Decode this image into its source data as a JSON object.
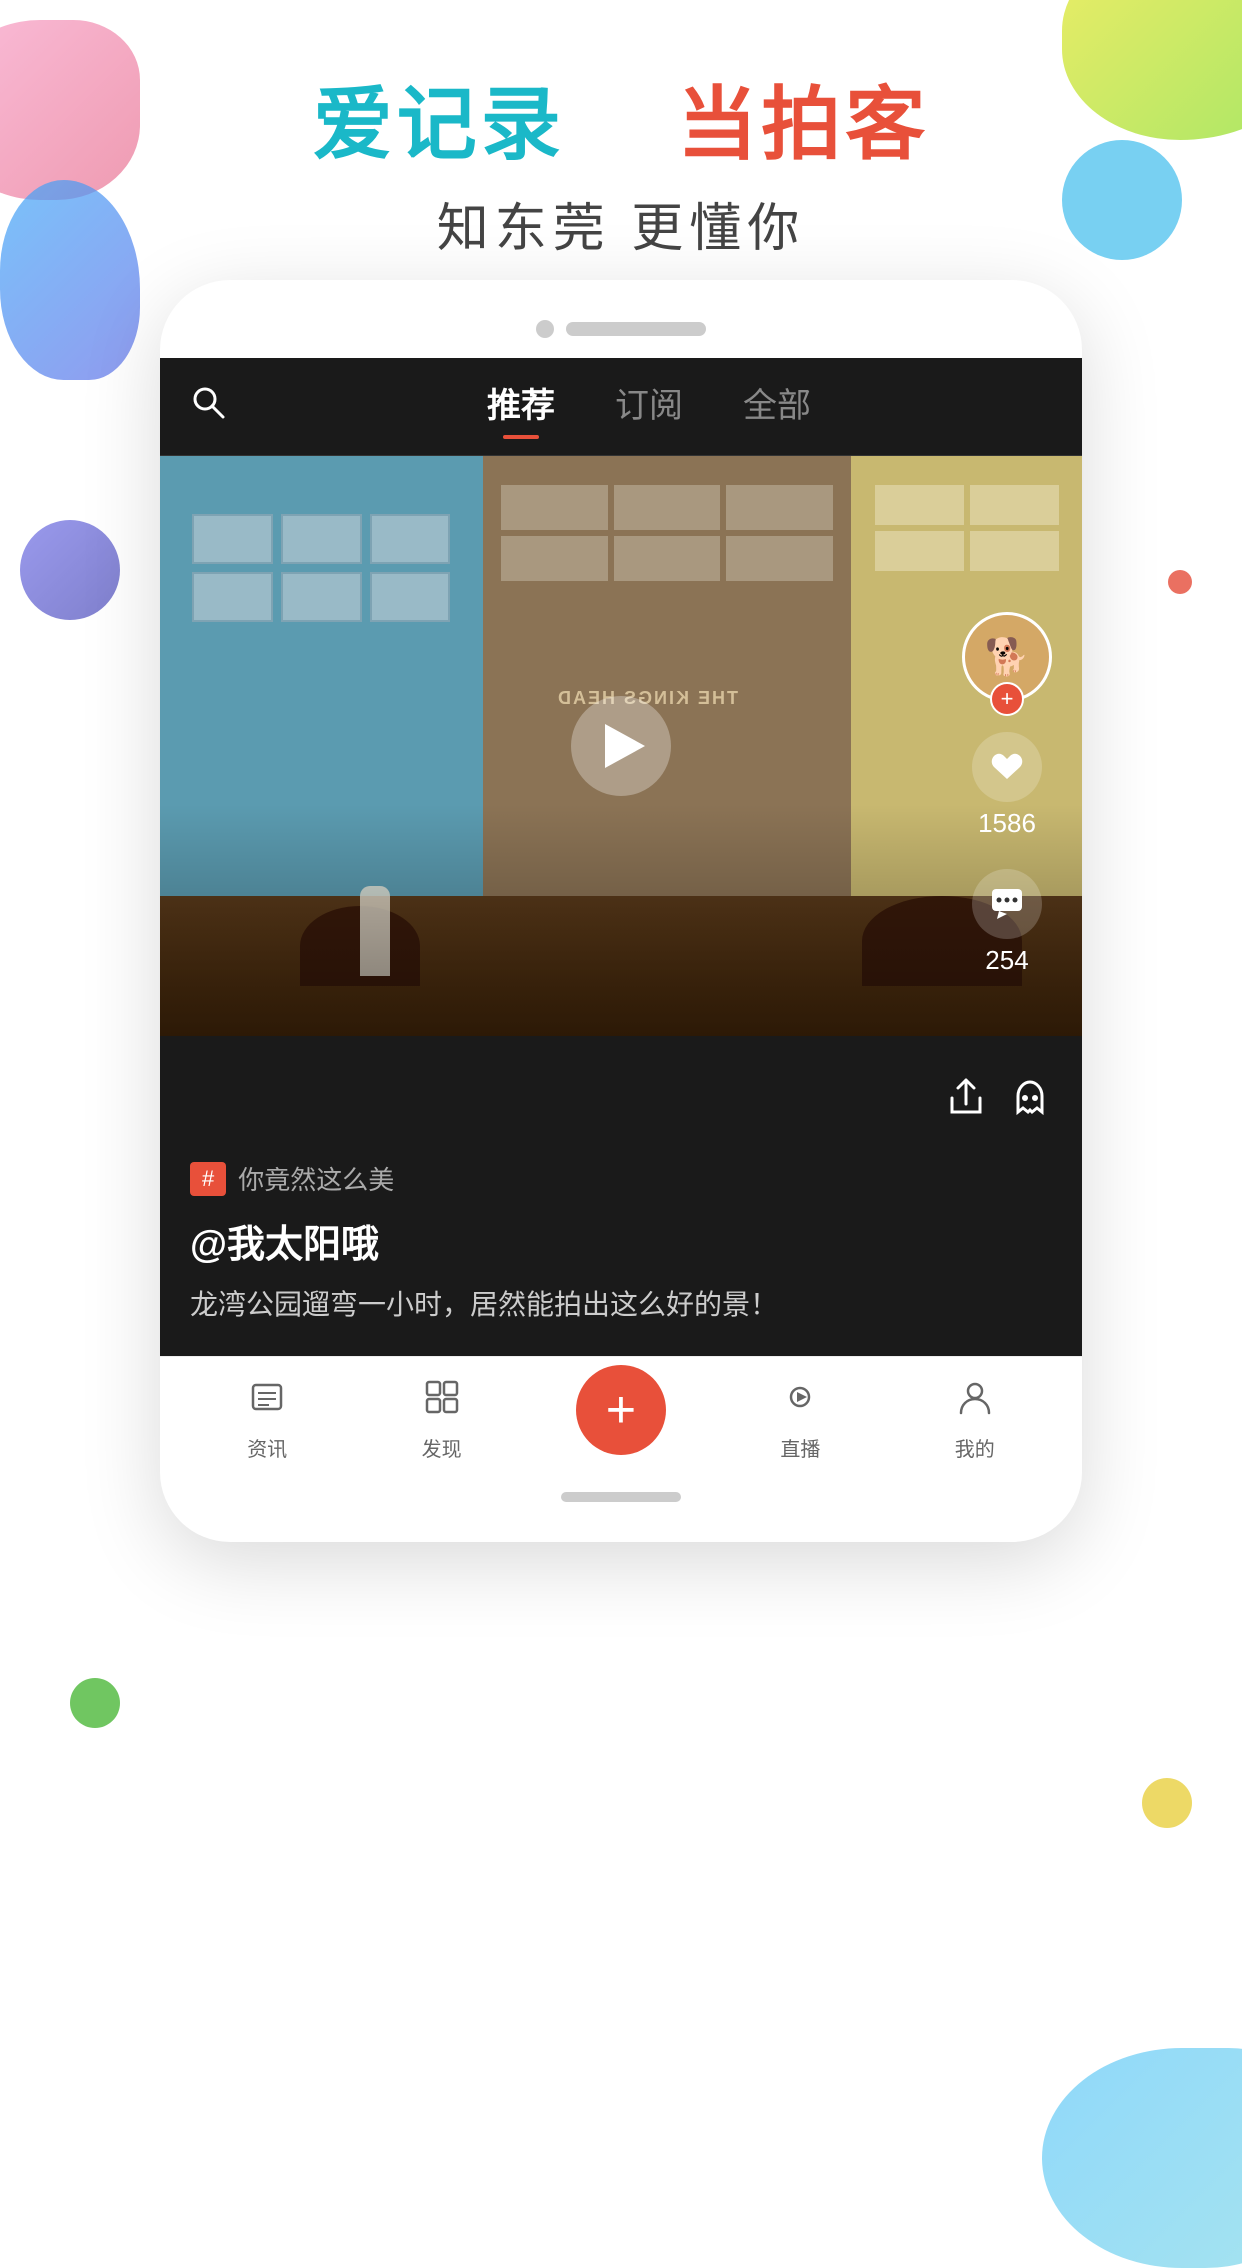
{
  "header": {
    "title_line1_part1": "爱记录",
    "title_line1_part2": "当拍客",
    "title_line2": "知东莞  更懂你"
  },
  "nav": {
    "search_label": "search",
    "tabs": [
      {
        "label": "推荐",
        "active": true
      },
      {
        "label": "订阅",
        "active": false
      },
      {
        "label": "全部",
        "active": false
      }
    ]
  },
  "video": {
    "likes_count": "1586",
    "comments_count": "254",
    "avatar_emoji": "🐕"
  },
  "post": {
    "hashtag_badge": "#",
    "hashtag_text": "你竟然这么美",
    "user": "@我太阳哦",
    "description": "龙湾公园遛弯一小时，居然能拍出这么好的景！"
  },
  "bottom_nav": {
    "items": [
      {
        "label": "资讯",
        "icon": "📋"
      },
      {
        "label": "发现",
        "icon": "🔍"
      },
      {
        "label": "+",
        "icon": "+"
      },
      {
        "label": "直播",
        "icon": "▶"
      },
      {
        "label": "我的",
        "icon": "👤"
      }
    ]
  },
  "share_icon": "↗",
  "ghost_icon": "👻"
}
